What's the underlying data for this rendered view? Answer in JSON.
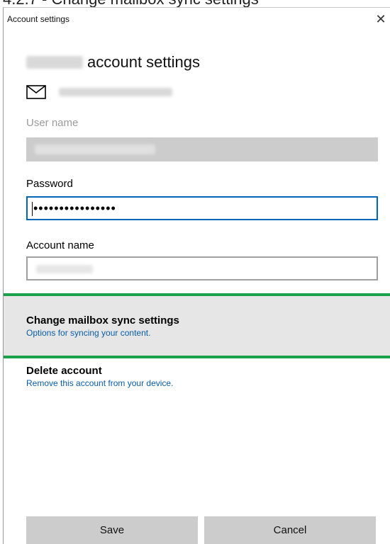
{
  "page_caption": "4.2.7 - Change mailbox sync settings",
  "dialog": {
    "window_title": "Account settings",
    "close_symbol": "✕",
    "heading_suffix": "account settings",
    "icons": [
      "mail-icon",
      "close-icon"
    ],
    "fields": {
      "username_label": "User name",
      "password_label": "Password",
      "password_value": "••••••••••••••••",
      "account_name_label": "Account name"
    },
    "options": [
      {
        "title": "Change mailbox sync settings",
        "subtitle": "Options for syncing your content."
      },
      {
        "title": "Delete account",
        "subtitle": "Remove this account from your device."
      }
    ],
    "buttons": {
      "save": "Save",
      "cancel": "Cancel"
    },
    "colors": {
      "focus_border": "#0067b8",
      "highlight_border": "#1aa14a",
      "link": "#0a5ca8"
    }
  }
}
